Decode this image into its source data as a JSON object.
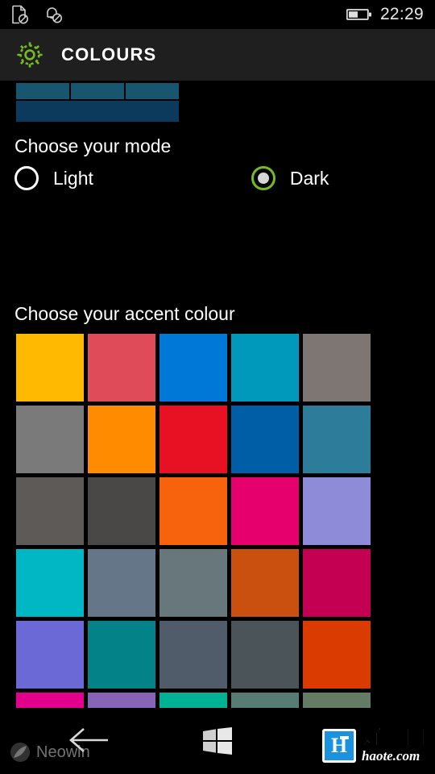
{
  "status_bar": {
    "icons": [
      "sim-disabled-icon",
      "notifications-off-icon",
      "battery-icon"
    ],
    "clock": "22:29"
  },
  "header": {
    "icon": "settings-gear-icon",
    "title": "COLOURS",
    "accent": "#76bc21",
    "background": "#1f1f1f"
  },
  "preview": {
    "name": "theme-preview-tiles",
    "small_tiles": [
      "#18556f",
      "#18556f",
      "#18556f"
    ],
    "wide_tile": "#0b3a5c"
  },
  "mode_section": {
    "title": "Choose your mode",
    "options": [
      {
        "label": "Light",
        "selected": false
      },
      {
        "label": "Dark",
        "selected": true
      }
    ],
    "selected_ring_colour": "#76bc21"
  },
  "accent_section": {
    "title": "Choose your accent colour",
    "columns": 5,
    "swatches": [
      {
        "name": "yellow-gold",
        "hex": "#ffb900"
      },
      {
        "name": "red-salmon",
        "hex": "#e04b5a"
      },
      {
        "name": "blue",
        "hex": "#0078d7"
      },
      {
        "name": "teal-cyan",
        "hex": "#0099bc"
      },
      {
        "name": "warm-grey",
        "hex": "#7e7673"
      },
      {
        "name": "grey",
        "hex": "#7a7a7a"
      },
      {
        "name": "orange",
        "hex": "#ff8c00"
      },
      {
        "name": "red",
        "hex": "#e81123"
      },
      {
        "name": "dark-blue",
        "hex": "#005ea6"
      },
      {
        "name": "steel-blue",
        "hex": "#2d7d9a"
      },
      {
        "name": "dark-grey",
        "hex": "#5d5a58"
      },
      {
        "name": "darker-grey",
        "hex": "#4a4846"
      },
      {
        "name": "bright-orange",
        "hex": "#f7630c"
      },
      {
        "name": "pink-magenta",
        "hex": "#e5006e"
      },
      {
        "name": "light-purple",
        "hex": "#8e8cd8"
      },
      {
        "name": "cyan",
        "hex": "#00b7c3"
      },
      {
        "name": "blue-grey",
        "hex": "#647687"
      },
      {
        "name": "grey-teal",
        "hex": "#68777c"
      },
      {
        "name": "burnt-orange",
        "hex": "#ca5010"
      },
      {
        "name": "crimson",
        "hex": "#c30052"
      },
      {
        "name": "indigo",
        "hex": "#6b69d6"
      },
      {
        "name": "deep-teal",
        "hex": "#038387"
      },
      {
        "name": "slate",
        "hex": "#515c6b"
      },
      {
        "name": "dark-slate",
        "hex": "#4a5459"
      },
      {
        "name": "red-orange",
        "hex": "#da3b01"
      },
      {
        "name": "magenta",
        "hex": "#e3008c"
      },
      {
        "name": "purple",
        "hex": "#8764b8"
      },
      {
        "name": "green-teal",
        "hex": "#00b294"
      },
      {
        "name": "sage-green",
        "hex": "#567c73"
      },
      {
        "name": "olive-green",
        "hex": "#647c64"
      }
    ]
  },
  "nav_bar": {
    "back": "back-arrow-icon",
    "start": "windows-start-icon"
  },
  "watermarks": {
    "left_text": "Neowin",
    "right_badge_letter": "H",
    "right_cn": "好特网",
    "right_domain": "haote.com",
    "right_badge_colour": "#1a92e0"
  }
}
